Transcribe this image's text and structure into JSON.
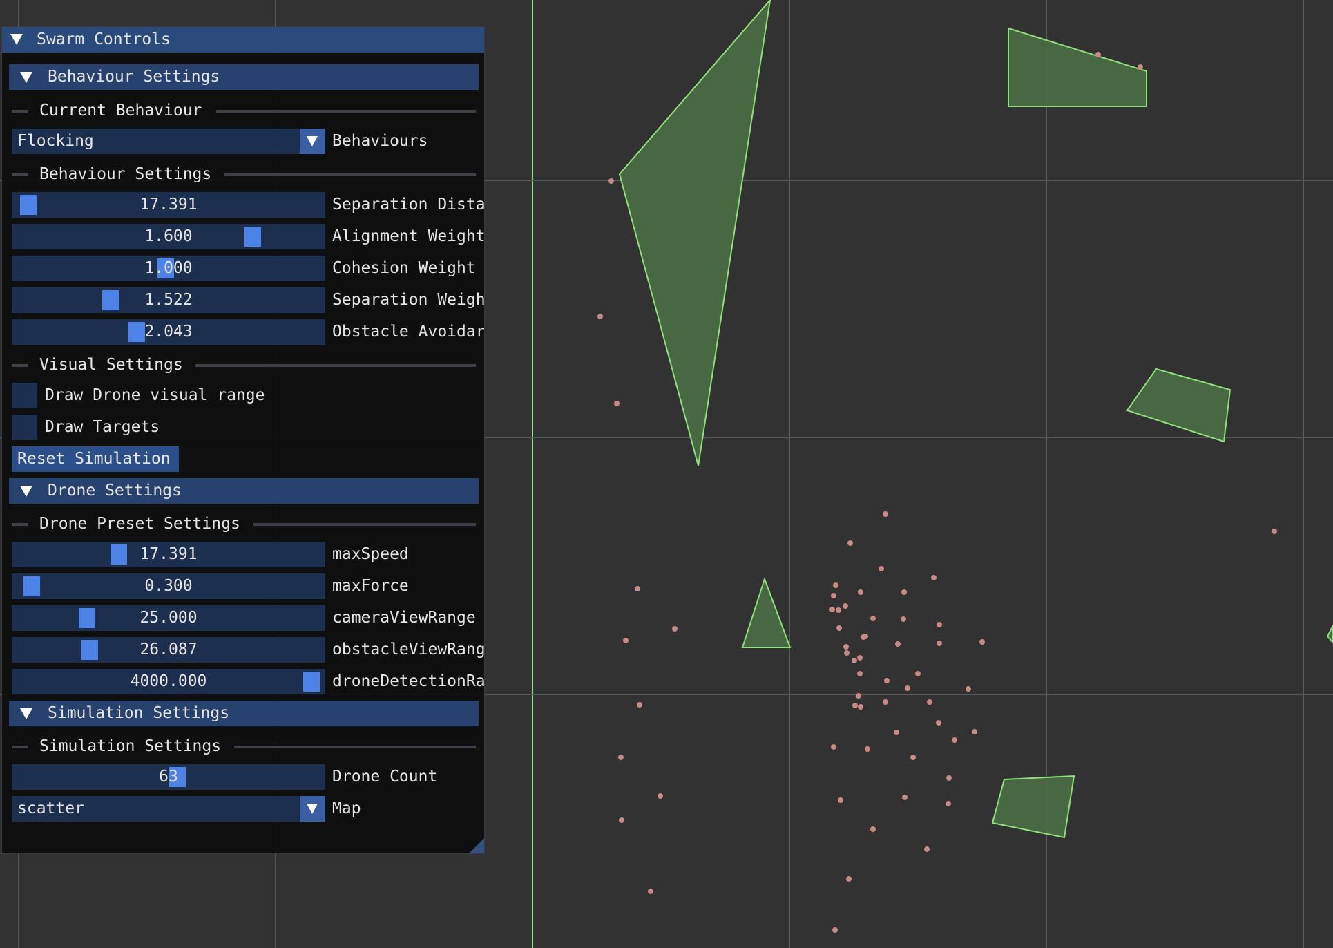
{
  "window": {
    "title": "Swarm Controls"
  },
  "behaviour_section": {
    "header": "Behaviour Settings",
    "current_behaviour_label": "Current Behaviour",
    "behaviour_combo": {
      "value": "Flocking",
      "label": "Behaviours"
    },
    "settings_label": "Behaviour Settings",
    "sliders": [
      {
        "value": "17.391",
        "label": "Separation Dista",
        "fill": 0.02
      },
      {
        "value": "1.600",
        "label": "Alignment Weight",
        "fill": 0.79
      },
      {
        "value": "1.000",
        "label": "Cohesion Weight",
        "fill": 0.49
      },
      {
        "value": "1.522",
        "label": "Separation Weigh",
        "fill": 0.3
      },
      {
        "value": "2.043",
        "label": "Obstacle Avoidar",
        "fill": 0.39
      }
    ],
    "visual_label": "Visual Settings",
    "checkboxes": [
      {
        "label": "Draw Drone visual range",
        "checked": false
      },
      {
        "label": "Draw Targets",
        "checked": false
      }
    ],
    "reset_button": "Reset Simulation"
  },
  "drone_section": {
    "header": "Drone Settings",
    "preset_label": "Drone Preset Settings",
    "sliders": [
      {
        "value": "17.391",
        "label": "maxSpeed",
        "fill": 0.33
      },
      {
        "value": "0.300",
        "label": "maxForce",
        "fill": 0.03
      },
      {
        "value": "25.000",
        "label": "cameraViewRange",
        "fill": 0.22
      },
      {
        "value": "26.087",
        "label": "obstacleViewRang",
        "fill": 0.23
      },
      {
        "value": "4000.000",
        "label": "droneDetectionRa",
        "fill": 0.99
      }
    ]
  },
  "simulation_section": {
    "header": "Simulation Settings",
    "settings_label": "Simulation Settings",
    "drone_count": {
      "value": "63",
      "label": "Drone Count",
      "fill": 0.53
    },
    "map_combo": {
      "value": "scatter",
      "label": "Map"
    }
  },
  "colors": {
    "background": "#323232",
    "grid": "#5a5a5a",
    "obstacle_fill": "#4a6a44",
    "obstacle_stroke": "#8fe07a",
    "drone": "#c88a86",
    "slider_grab": "#4d82e6",
    "frame_bg": "#1d2f4e",
    "header_bg": "#284270"
  }
}
